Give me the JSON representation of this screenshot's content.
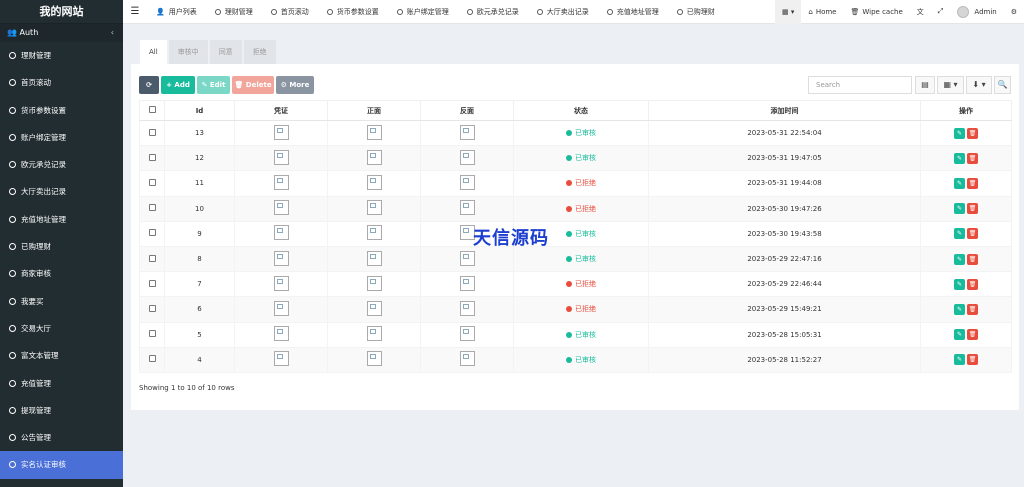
{
  "sidebar": {
    "logo": "我的网站",
    "auth_label": "Auth",
    "items": [
      {
        "label": "理财管理"
      },
      {
        "label": "首页滚动"
      },
      {
        "label": "货币参数设置"
      },
      {
        "label": "账户绑定管理"
      },
      {
        "label": "欧元承兑记录"
      },
      {
        "label": "大厅卖出记录"
      },
      {
        "label": "充值地址管理"
      },
      {
        "label": "已购理财"
      },
      {
        "label": "商家审核"
      },
      {
        "label": "我要买"
      },
      {
        "label": "交易大厅"
      },
      {
        "label": "富文本管理"
      },
      {
        "label": "充值管理"
      },
      {
        "label": "提现管理"
      },
      {
        "label": "公告管理"
      },
      {
        "label": "实名认证审核"
      }
    ]
  },
  "topnav": {
    "items": [
      "用户列表",
      "理财管理",
      "首页滚动",
      "货币参数设置",
      "账户绑定管理",
      "欧元承兑记录",
      "大厅卖出记录",
      "充值地址管理",
      "已购理财"
    ],
    "home": "Home",
    "wipe_cache": "Wipe cache",
    "user": "Admin"
  },
  "tabs": [
    "All",
    "审核中",
    "同意",
    "拒绝"
  ],
  "toolbar": {
    "refresh": "⟳",
    "add": "+ Add",
    "edit": "✎ Edit",
    "delete": "🗑 Delete",
    "more": "⚙ More",
    "search_placeholder": "Search"
  },
  "table": {
    "headers": [
      "Id",
      "凭证",
      "正面",
      "反面",
      "状态",
      "添加时间",
      "操作"
    ],
    "rows": [
      {
        "id": "13",
        "status": "已审核",
        "time": "2023-05-31 22:54:04"
      },
      {
        "id": "12",
        "status": "已审核",
        "time": "2023-05-31 19:47:05"
      },
      {
        "id": "11",
        "status": "已拒绝",
        "time": "2023-05-31 19:44:08"
      },
      {
        "id": "10",
        "status": "已拒绝",
        "time": "2023-05-30 19:47:26"
      },
      {
        "id": "9",
        "status": "已审核",
        "time": "2023-05-30 19:43:58"
      },
      {
        "id": "8",
        "status": "已审核",
        "time": "2023-05-29 22:47:16"
      },
      {
        "id": "7",
        "status": "已拒绝",
        "time": "2023-05-29 22:46:44"
      },
      {
        "id": "6",
        "status": "已拒绝",
        "time": "2023-05-29 15:49:21"
      },
      {
        "id": "5",
        "status": "已审核",
        "time": "2023-05-28 15:05:31"
      },
      {
        "id": "4",
        "status": "已审核",
        "time": "2023-05-28 11:52:27"
      }
    ]
  },
  "footer": "Showing 1 to 10 of 10 rows",
  "watermark": "天信源码",
  "colors": {
    "approved": "#18bc9c",
    "rejected": "#e74c3c",
    "sidebar": "#222d32",
    "active": "#4a6fd6"
  }
}
